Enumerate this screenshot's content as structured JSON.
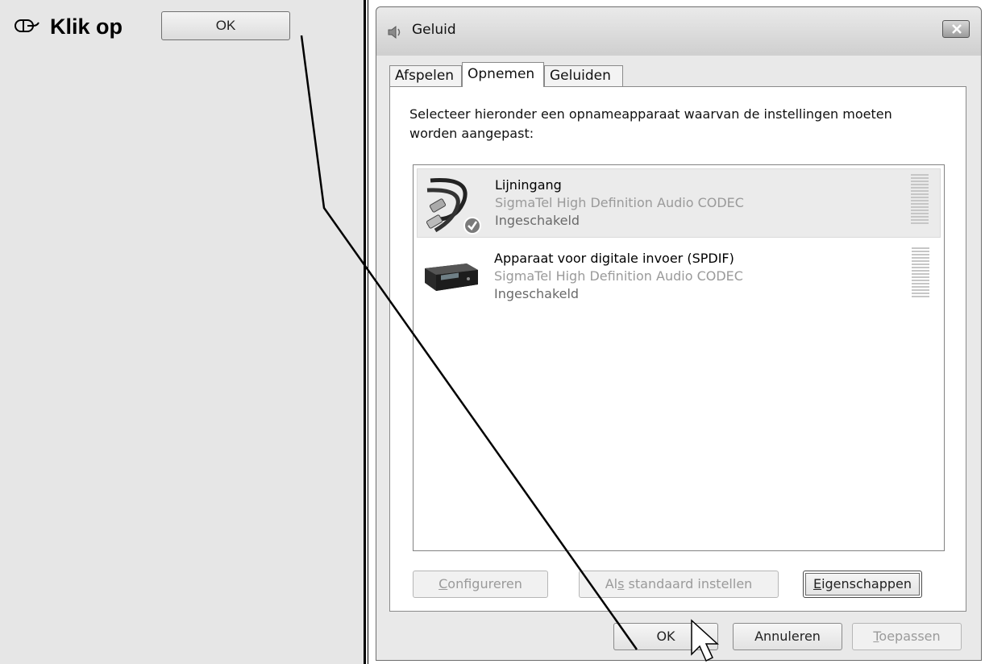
{
  "instruction": {
    "text": "Klik op",
    "button_label": "OK",
    "icon": "mouse-icon"
  },
  "dialog": {
    "title": "Geluid",
    "title_icon": "speaker-icon",
    "tabs": [
      {
        "label": "Afspelen",
        "active": false
      },
      {
        "label": "Opnemen",
        "active": true
      },
      {
        "label": "Geluiden",
        "active": false
      }
    ],
    "instruction_text": "Selecteer hieronder een opnameapparaat waarvan de instellingen moeten worden aangepast:",
    "devices": [
      {
        "name": "Lijningang",
        "driver": "SigmaTel High Definition Audio CODEC",
        "status": "Ingeschakeld",
        "default": true,
        "selected": true,
        "icon": "audio-cable-icon"
      },
      {
        "name": "Apparaat voor digitale invoer (SPDIF)",
        "driver": "SigmaTel High Definition Audio CODEC",
        "status": "Ingeschakeld",
        "default": false,
        "selected": false,
        "icon": "receiver-icon"
      }
    ],
    "buttons": {
      "configure": {
        "pre": "",
        "accel": "C",
        "post": "onfigureren",
        "enabled": false
      },
      "set_default": {
        "pre": "Al",
        "accel": "s",
        "post": " standaard instellen",
        "enabled": false
      },
      "properties": {
        "pre": "",
        "accel": "E",
        "post": "igenschappen",
        "enabled": true
      },
      "ok": {
        "label": "OK",
        "enabled": true
      },
      "cancel": {
        "label": "Annuleren",
        "enabled": true
      },
      "apply": {
        "pre": "",
        "accel": "T",
        "post": "oepassen",
        "enabled": false
      }
    }
  },
  "colors": {
    "background": "#e6e6e6",
    "selected_row": "#ebebeb",
    "disabled_text": "#9a9a9a",
    "callout_line": "#000000"
  }
}
